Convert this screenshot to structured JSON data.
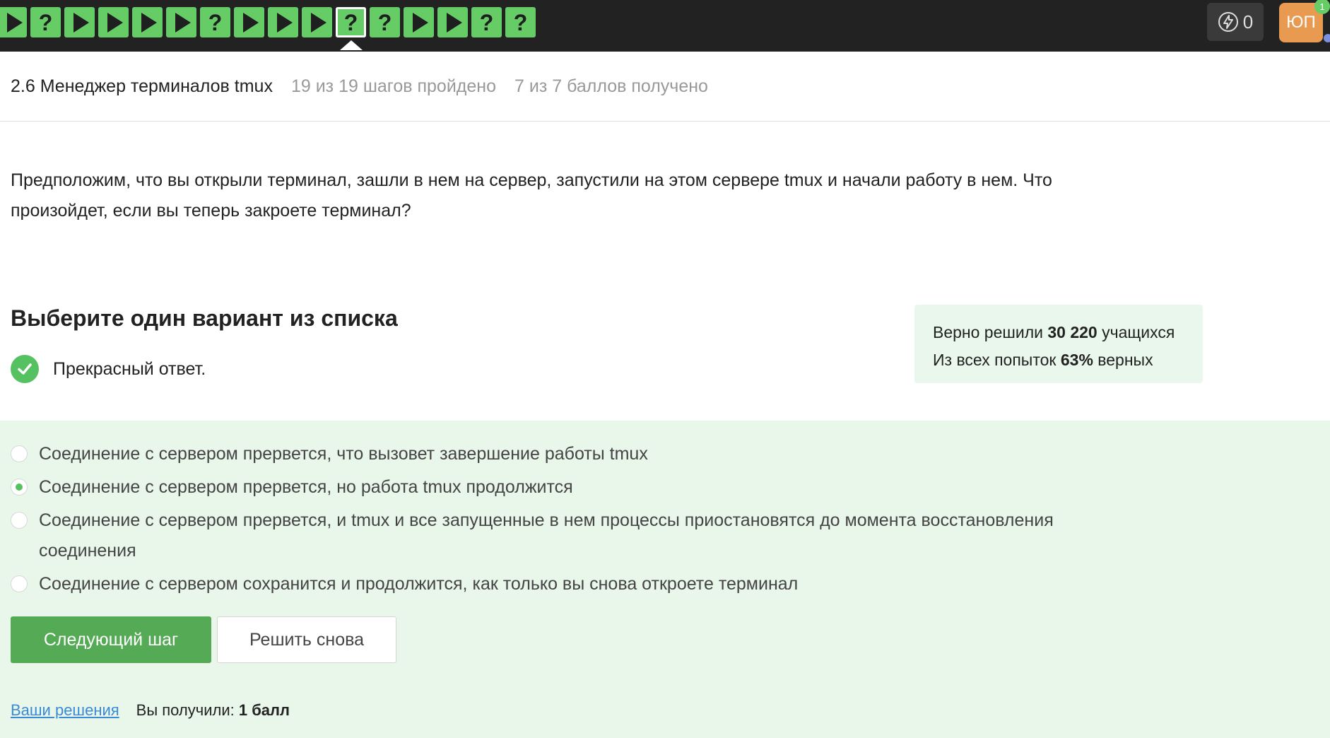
{
  "steps": [
    {
      "icon": "play-icon",
      "label": ""
    },
    {
      "icon": "question-icon",
      "label": "?"
    },
    {
      "icon": "play-icon",
      "label": ""
    },
    {
      "icon": "play-icon",
      "label": ""
    },
    {
      "icon": "play-icon",
      "label": ""
    },
    {
      "icon": "play-icon",
      "label": ""
    },
    {
      "icon": "question-icon",
      "label": "?"
    },
    {
      "icon": "play-icon",
      "label": ""
    },
    {
      "icon": "play-icon",
      "label": ""
    },
    {
      "icon": "play-icon",
      "label": ""
    },
    {
      "icon": "question-icon",
      "label": "?",
      "current": true
    },
    {
      "icon": "question-icon",
      "label": "?"
    },
    {
      "icon": "play-icon",
      "label": ""
    },
    {
      "icon": "play-icon",
      "label": ""
    },
    {
      "icon": "question-icon",
      "label": "?"
    },
    {
      "icon": "question-icon",
      "label": "?"
    }
  ],
  "header": {
    "energy_count": "0",
    "avatar_initials": "ЮП",
    "notification_count": "1"
  },
  "lesson": {
    "title": "2.6 Менеджер терминалов tmux",
    "progress": "19 из 19 шагов пройдено",
    "score": "7 из 7 баллов  получено"
  },
  "question": {
    "text": "Предположим, что вы открыли терминал, зашли в нем на сервер, запустили на этом сервере tmux и начали работу в нем. Что произойдет, если вы теперь закроете терминал?"
  },
  "quiz": {
    "choose_title": "Выберите один вариант из списка",
    "feedback": "Прекрасный ответ.",
    "stats_solved_prefix": "Верно решили ",
    "stats_solved_count": "30 220",
    "stats_solved_suffix": " учащихся",
    "stats_attempts_prefix": "Из всех попыток ",
    "stats_attempts_percent": "63%",
    "stats_attempts_suffix": " верных",
    "options": [
      {
        "text": "Соединение с сервером прервется, что вызовет завершение работы tmux",
        "selected": false
      },
      {
        "text": "Соединение с сервером прервется, но работа tmux продолжится",
        "selected": true
      },
      {
        "text": "Соединение с сервером прервется, и tmux и все запущенные в нем процессы приостановятся до момента восстановления соединения",
        "selected": false
      },
      {
        "text": "Соединение с сервером сохранится и продолжится, как только вы снова откроете терминал",
        "selected": false
      }
    ],
    "next_button": "Следующий шаг",
    "retry_button": "Решить снова",
    "solutions_link": "Ваши решения",
    "received_prefix": "Вы получили: ",
    "received_value": "1 балл"
  },
  "colors": {
    "step_green": "#66cc66",
    "topbar": "#222222",
    "answers_bg": "#e9f6ea",
    "primary_button": "#55aa55",
    "link": "#3b8ad6"
  }
}
